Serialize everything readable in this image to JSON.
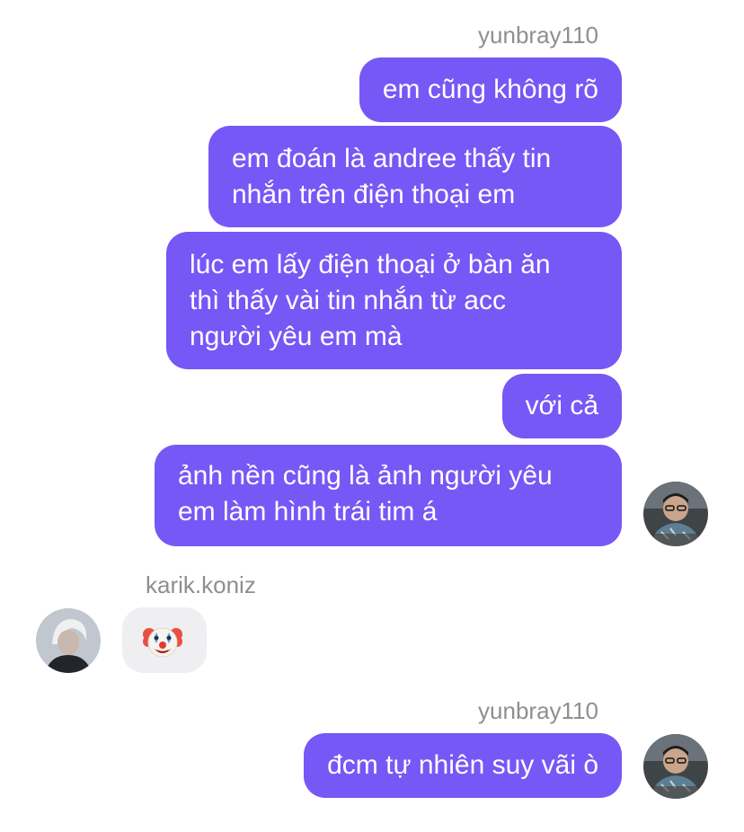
{
  "thread": {
    "sender_top": "yunbray110",
    "sender_middle": "karik.koniz",
    "sender_bottom": "yunbray110",
    "messages": [
      {
        "lines": [
          "em cũng không rõ"
        ]
      },
      {
        "lines": [
          "em đoán là andree thấy tin",
          "nhắn trên điện thoại em"
        ]
      },
      {
        "lines": [
          "lúc em lấy điện thoại ở bàn ăn",
          "thì thấy vài tin nhắn từ acc",
          "người yêu em mà"
        ]
      },
      {
        "lines": [
          "với cả"
        ]
      },
      {
        "lines": [
          "ảnh nền cũng là ảnh người yêu",
          "em làm hình trái tim á"
        ]
      },
      {
        "lines": [
          "đcm tự nhiên suy vãi ò"
        ]
      }
    ],
    "reaction_emoji": "clown-face"
  },
  "colors": {
    "sent_bubble": "#7558f6",
    "received_bubble": "#efeff2",
    "sender_label": "#8e8e93"
  },
  "icons": {
    "me_avatar": "avatar-photo-yunbray110",
    "other_avatar": "avatar-photo-karik",
    "clown": "clown-face-emoji"
  }
}
